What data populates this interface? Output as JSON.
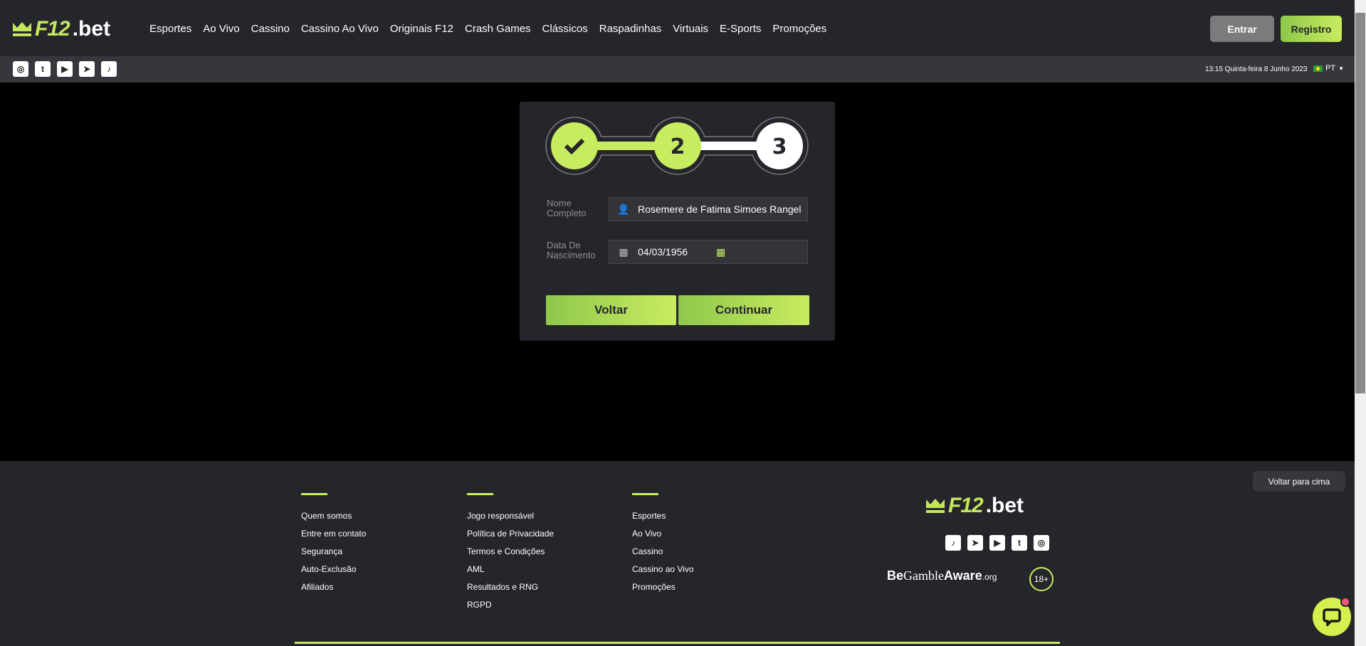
{
  "brand": {
    "logo_f12": "F12",
    "logo_bet": ".bet",
    "accent": "#c8ec60",
    "bg": "#25262b"
  },
  "nav": [
    "Esportes",
    "Ao Vivo",
    "Cassino",
    "Cassino Ao Vivo",
    "Originais F12",
    "Crash Games",
    "Clássicos",
    "Raspadinhas",
    "Virtuais",
    "E-Sports",
    "Promoções"
  ],
  "header": {
    "login": "Entrar",
    "register": "Registro"
  },
  "subbar": {
    "social": [
      "instagram-icon",
      "twitter-icon",
      "youtube-icon",
      "telegram-icon",
      "tiktok-icon"
    ],
    "datetime": "13:15 Quinta-feira 8 Junho 2023",
    "language": "PT"
  },
  "stepper": {
    "steps": [
      "✔",
      "2",
      "3"
    ],
    "current": 2
  },
  "form": {
    "name_label_1": "Nome",
    "name_label_2": "Completo",
    "name_value": "Rosemere de Fatima Simoes Rangel",
    "dob_label_1": "Data De",
    "dob_label_2": "Nascimento",
    "dob_value": "04/03/1956",
    "back": "Voltar",
    "continue": "Continuar"
  },
  "footer": {
    "col1": [
      "Quem somos",
      "Entre em contato",
      "Segurança",
      "Auto-Exclusão",
      "Afiliados"
    ],
    "col2": [
      "Jogo responsável",
      "Política de Privacidade",
      "Termos e Condições",
      "AML",
      "Resultados e RNG",
      "RGPD"
    ],
    "col3": [
      "Esportes",
      "Ao Vivo",
      "Cassino",
      "Cassino ao Vivo",
      "Promoções"
    ],
    "social": [
      "tiktok-icon",
      "telegram-icon",
      "youtube-icon",
      "twitter-icon",
      "instagram-icon"
    ],
    "bga_be": "Be",
    "bga_gamble": "Gamble",
    "bga_aware": "Aware",
    "bga_org": ".org",
    "age": "18+",
    "back_to_top": "Voltar para cima"
  }
}
